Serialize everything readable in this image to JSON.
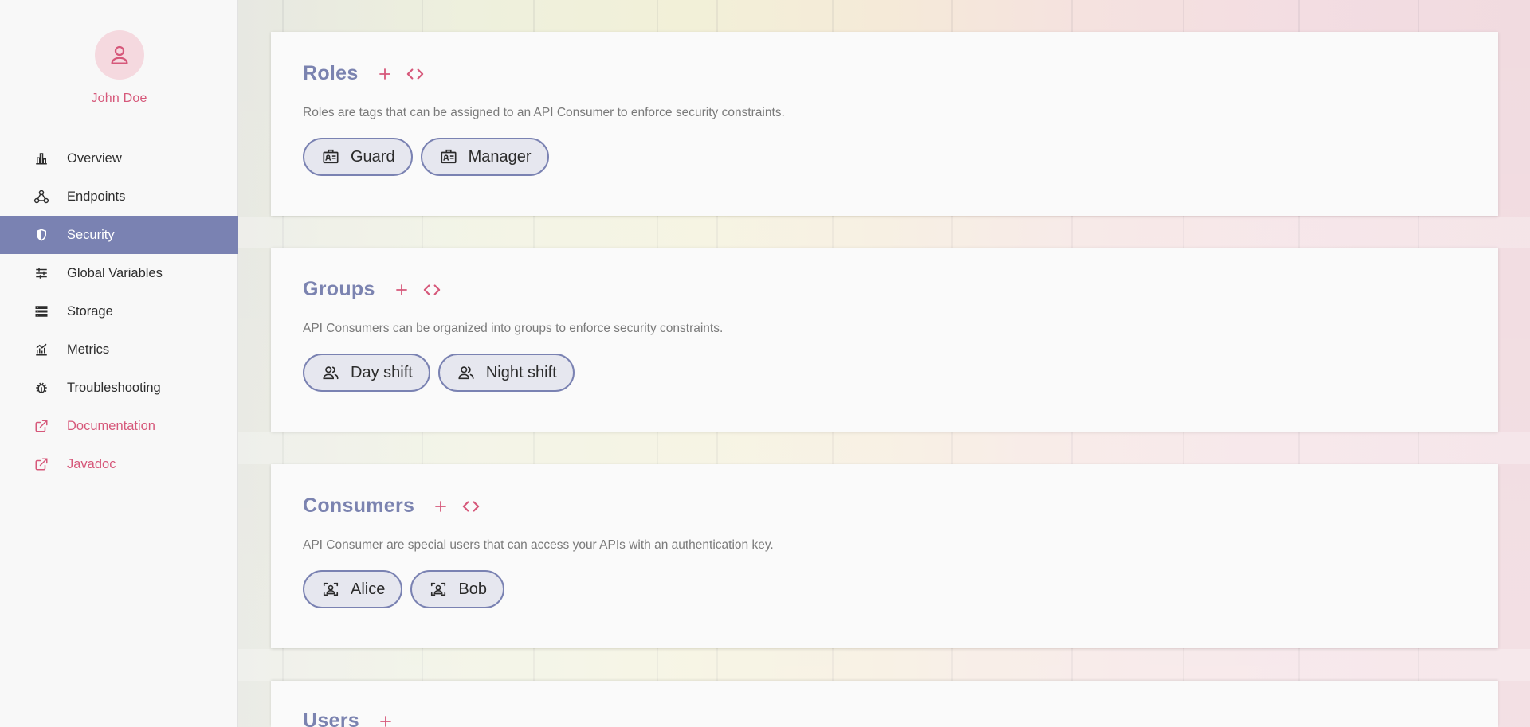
{
  "user": {
    "name": "John Doe",
    "avatar_icon": "user-icon"
  },
  "nav": {
    "items": [
      {
        "label": "Overview",
        "icon": "bar-chart-icon"
      },
      {
        "label": "Endpoints",
        "icon": "webhook-icon"
      },
      {
        "label": "Security",
        "icon": "shield-icon",
        "active": true
      },
      {
        "label": "Global Variables",
        "icon": "sliders-icon"
      },
      {
        "label": "Storage",
        "icon": "storage-icon"
      },
      {
        "label": "Metrics",
        "icon": "metrics-icon"
      },
      {
        "label": "Troubleshooting",
        "icon": "bug-icon"
      },
      {
        "label": "Documentation",
        "icon": "external-link-icon"
      },
      {
        "label": "Javadoc",
        "icon": "external-link-icon"
      }
    ]
  },
  "sections": {
    "roles": {
      "title": "Roles",
      "description": "Roles are tags that can be assigned to an API Consumer to enforce security constraints.",
      "items": [
        "Guard",
        "Manager"
      ]
    },
    "groups": {
      "title": "Groups",
      "description": "API Consumers can be organized into groups to enforce security constraints.",
      "items": [
        "Day shift",
        "Night shift"
      ]
    },
    "consumers": {
      "title": "Consumers",
      "description": "API Consumer are special users that can access your APIs with an authentication key.",
      "items": [
        "Alice",
        "Bob"
      ]
    },
    "users": {
      "title": "Users"
    }
  },
  "colors": {
    "accent": "#d6587a",
    "primary": "#7a82b2",
    "title": "#7b83b0"
  }
}
